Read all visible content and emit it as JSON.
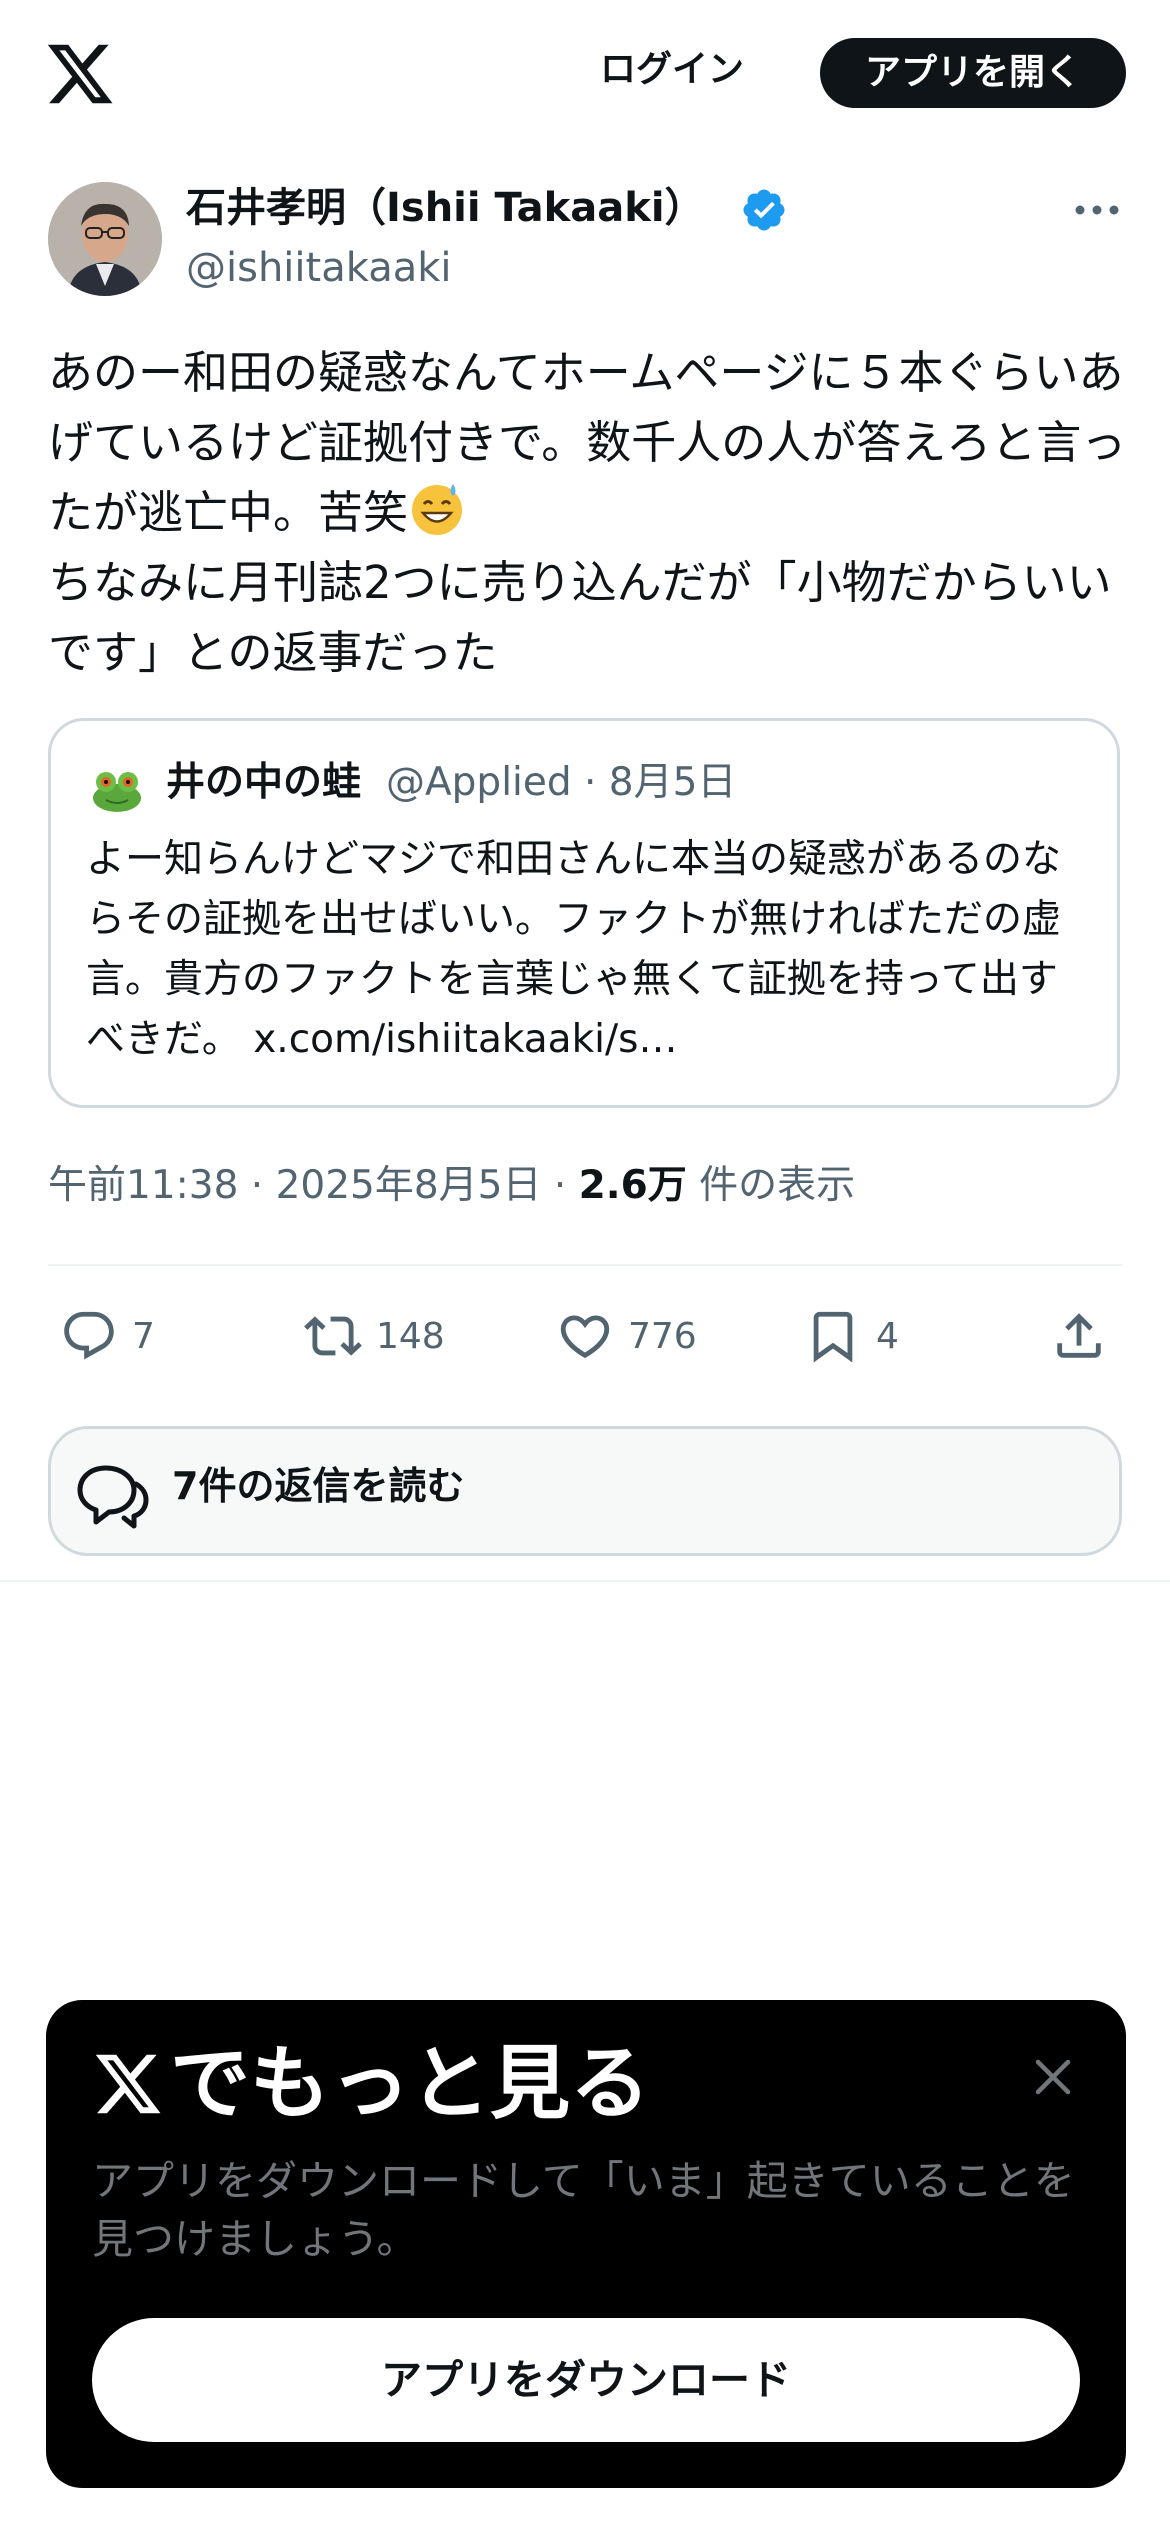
{
  "header": {
    "logo_icon": "x-logo-icon",
    "login_label": "ログイン",
    "open_app_label": "アプリを開く"
  },
  "post": {
    "author": {
      "display_name": "石井孝明（Ishii Takaaki）",
      "handle": "@ishiitakaaki",
      "verified_icon": "verified-badge-icon",
      "avatar_icon": "avatar-photo"
    },
    "text_lines": [
      "あのー和田の疑惑なんてホームページに５本ぐらいあげているけど証拠付きで。数千人の人が答えろと言ったが逃亡中。苦笑",
      "ちなみに月刊誌2つに売り込んだが「小物だからいいです」との返事だった"
    ],
    "emoji": "😅",
    "quote": {
      "display_name": "井の中の蛙",
      "handle_date": "@Applied · 8月5日",
      "text": "よー知らんけどマジで和田さんに本当の疑惑があるのならその証拠を出せばいい。ファクトが無ければただの虚言。貴方のファクトを言葉じゃ無くて証拠を持って出すべきだ。 x.com/ishiitakaaki/s…"
    },
    "timestamp": "午前11:38 · 2025年8月5日 · ",
    "views_count": "2.6万",
    "views_label": " 件の表示",
    "actions": {
      "reply_count": "7",
      "repost_count": "148",
      "like_count": "776",
      "bookmark_count": "4"
    },
    "read_replies_label": "7件の返信を読む"
  },
  "promo": {
    "title": "でもっと見る",
    "description": "アプリをダウンロードして「いま」起きていることを見つけましょう。",
    "download_label": "アプリをダウンロード"
  },
  "colors": {
    "primary_text": "#0f1419",
    "secondary_text": "#536471",
    "verified_blue": "#1d9bf0",
    "border": "#cfd9de"
  }
}
